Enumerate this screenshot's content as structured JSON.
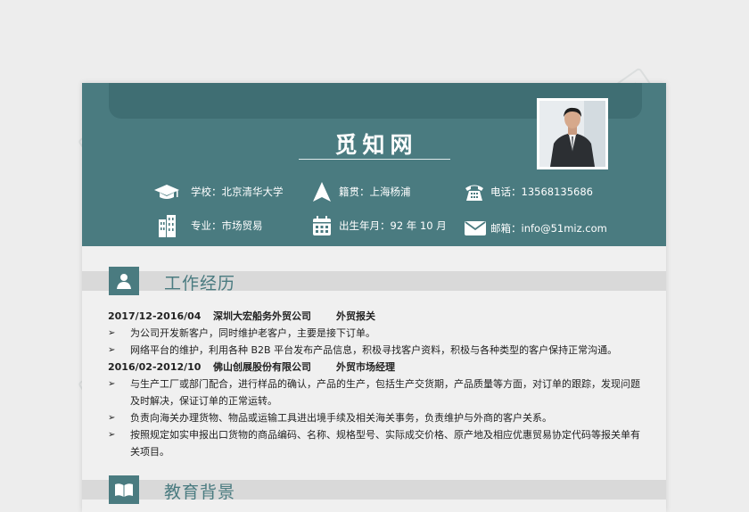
{
  "resume": {
    "name": "觅知网",
    "watermark": "觅知网",
    "info": {
      "school": "学校：北京清华大学",
      "origin": "籍贯：上海杨浦",
      "phone": "电话：13568135686",
      "major": "专业：市场贸易",
      "birth": "出生年月：92 年 10 月",
      "email": "邮箱：info@51miz.com"
    },
    "sections": {
      "work": "工作经历",
      "education": "教育背景"
    },
    "jobs": [
      {
        "date": "2017/12-2016/04",
        "company": "深圳大宏船务外贸公司",
        "title": "外贸报关",
        "bullets": [
          "为公司开发新客户，同时维护老客户，主要是接下订单。",
          "网络平台的维护，利用各种 B2B 平台发布产品信息，积极寻找客户资料，积极与各种类型的客户保持正常沟通。"
        ]
      },
      {
        "date": "2016/02-2012/10",
        "company": "佛山创展股份有限公司",
        "title": "外贸市场经理",
        "bullets": [
          "与生产工厂或部门配合，进行样品的确认，产品的生产，包括生产交货期，产品质量等方面，对订单的跟踪，发现问题及时解决，保证订单的正常运转。",
          "负责向海关办理货物、物品或运输工具进出境手续及相关海关事务，负责维护与外商的客户关系。",
          "按照规定如实申报出口货物的商品编码、名称、规格型号、实际成交价格、原产地及相应优惠贸易协定代码等报关单有关项目。"
        ]
      }
    ],
    "bullet_mark": "➢"
  }
}
